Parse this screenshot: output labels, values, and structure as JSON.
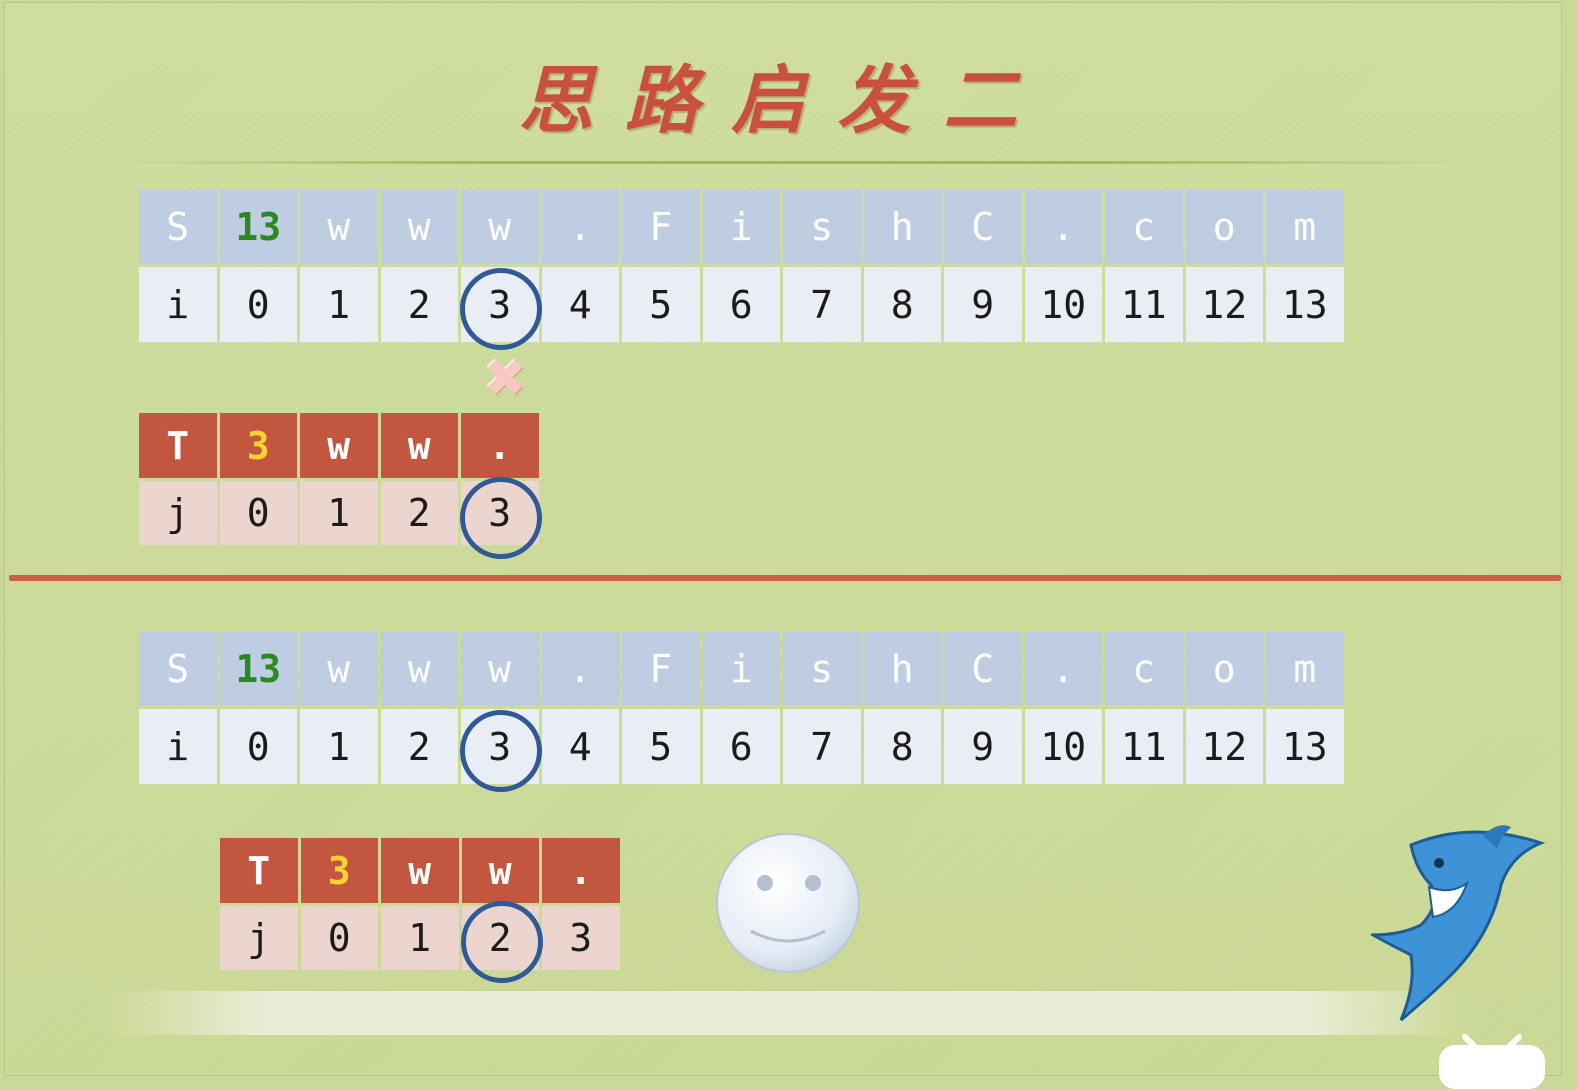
{
  "slide": {
    "title": "思路启发二"
  },
  "top": {
    "s_table": {
      "head": [
        "S",
        "13",
        "w",
        "w",
        "w",
        ".",
        "F",
        "i",
        "s",
        "h",
        "C",
        ".",
        "c",
        "o",
        "m"
      ],
      "index": [
        "i",
        "0",
        "1",
        "2",
        "3",
        "4",
        "5",
        "6",
        "7",
        "8",
        "9",
        "10",
        "11",
        "12",
        "13"
      ]
    },
    "mismatch_mark": "✖",
    "t_table": {
      "head": [
        "T",
        "3",
        "w",
        "w",
        "."
      ],
      "index": [
        "j",
        "0",
        "1",
        "2",
        "3"
      ]
    }
  },
  "bottom": {
    "s_table": {
      "head": [
        "S",
        "13",
        "w",
        "w",
        "w",
        ".",
        "F",
        "i",
        "s",
        "h",
        "C",
        ".",
        "c",
        "o",
        "m"
      ],
      "index": [
        "i",
        "0",
        "1",
        "2",
        "3",
        "4",
        "5",
        "6",
        "7",
        "8",
        "9",
        "10",
        "11",
        "12",
        "13"
      ]
    },
    "t_table": {
      "head": [
        "T",
        "3",
        "w",
        "w",
        "."
      ],
      "index": [
        "j",
        "0",
        "1",
        "2",
        "3"
      ]
    }
  },
  "decorations": {
    "smiley_icon": "smiley-face-icon",
    "shark_icon": "shark-mascot-icon",
    "corner_icon": "tv-logo-icon"
  },
  "colors": {
    "title": "#c9503a",
    "s_header": "#bfcde3",
    "s_body": "#e9edf4",
    "t_header": "#c2563f",
    "t_body": "#ecd5cf",
    "length_green": "#2b8a1e",
    "length_yellow": "#f7d330",
    "ring": "#2f5a96",
    "divider": "#cd5f45"
  }
}
